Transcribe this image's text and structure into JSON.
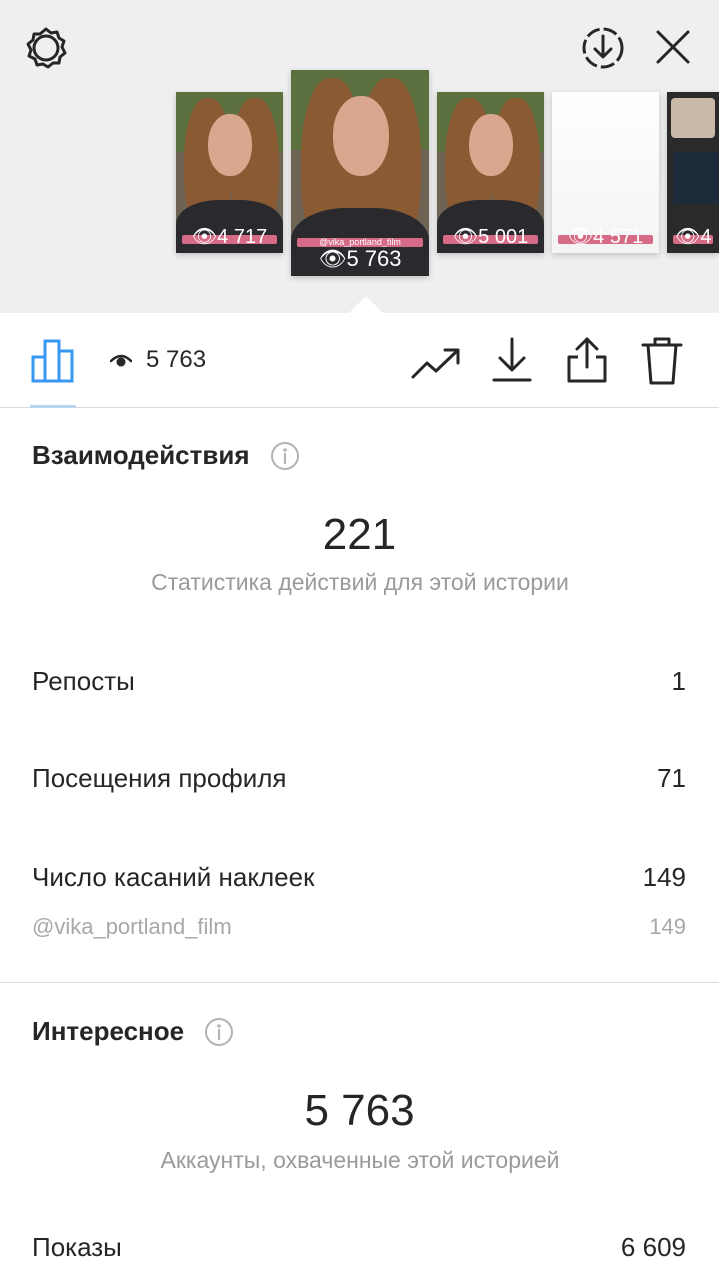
{
  "thumbnails": [
    {
      "views": "4 717"
    },
    {
      "views": "5 763",
      "tag": "@vika_portland_film"
    },
    {
      "views": "5 001"
    },
    {
      "views": "4 571"
    },
    {
      "views": "4"
    }
  ],
  "toolbar": {
    "views": "5 763"
  },
  "interactions": {
    "title": "Взаимодействия",
    "total": "221",
    "subtitle": "Статистика действий для этой истории",
    "rows": [
      {
        "label": "Репосты",
        "value": "1"
      },
      {
        "label": "Посещения профиля",
        "value": "71"
      },
      {
        "label": "Число касаний наклеек",
        "value": "149"
      }
    ],
    "sticker": {
      "label": "@vika_portland_film",
      "value": "149"
    }
  },
  "discovery": {
    "title": "Интересное",
    "total": "5 763",
    "subtitle": "Аккаунты, охваченные этой историей",
    "rows": [
      {
        "label": "Показы",
        "value": "6 609"
      }
    ]
  },
  "colors": {
    "accent": "#3897f0",
    "secondary_text": "#9a9a9a",
    "top_background": "#efefef"
  }
}
